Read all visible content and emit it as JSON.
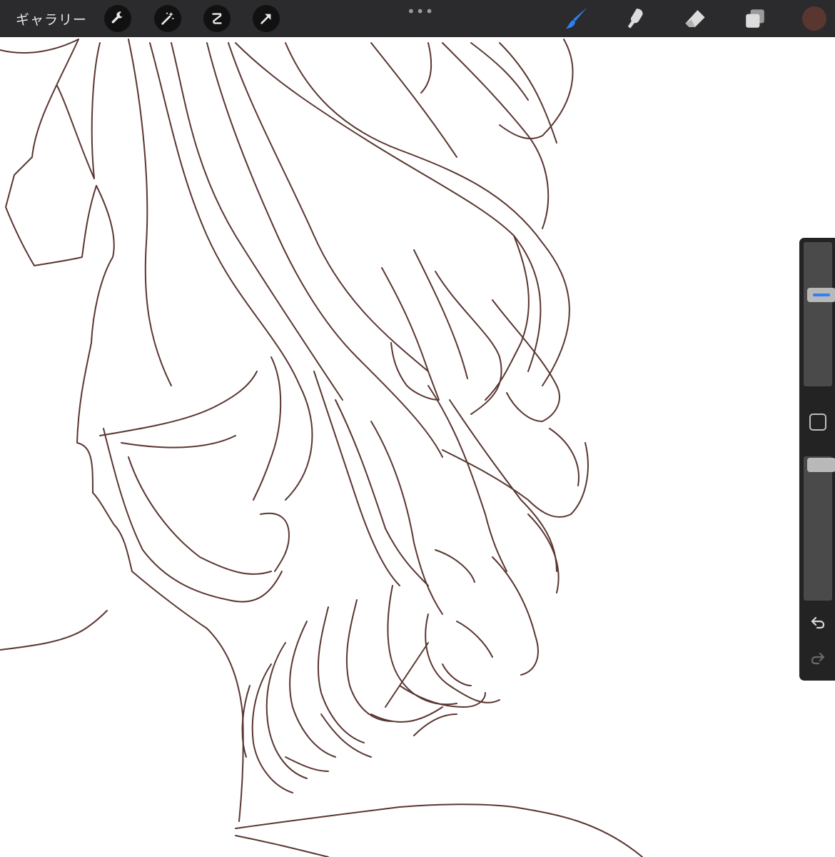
{
  "topbar": {
    "gallery_label": "ギャラリー",
    "more_label": "•••",
    "tools_left": [
      "wrench-icon",
      "magic-wand-icon",
      "selection-icon",
      "transform-arrow-icon"
    ],
    "tools_right": [
      "brush-icon",
      "smudge-icon",
      "eraser-icon",
      "layers-icon"
    ],
    "active_tool": "brush-icon"
  },
  "colors": {
    "active_tool": "#2f7ff5",
    "current_color": "#5a3630",
    "line_art": "#5a3630",
    "toolbar_bg": "#2b2b2d"
  },
  "sidebar": {
    "brush_size": 0.65,
    "brush_opacity": 1.0,
    "buttons": [
      "modify-square-icon",
      "undo-icon",
      "redo-icon"
    ]
  }
}
